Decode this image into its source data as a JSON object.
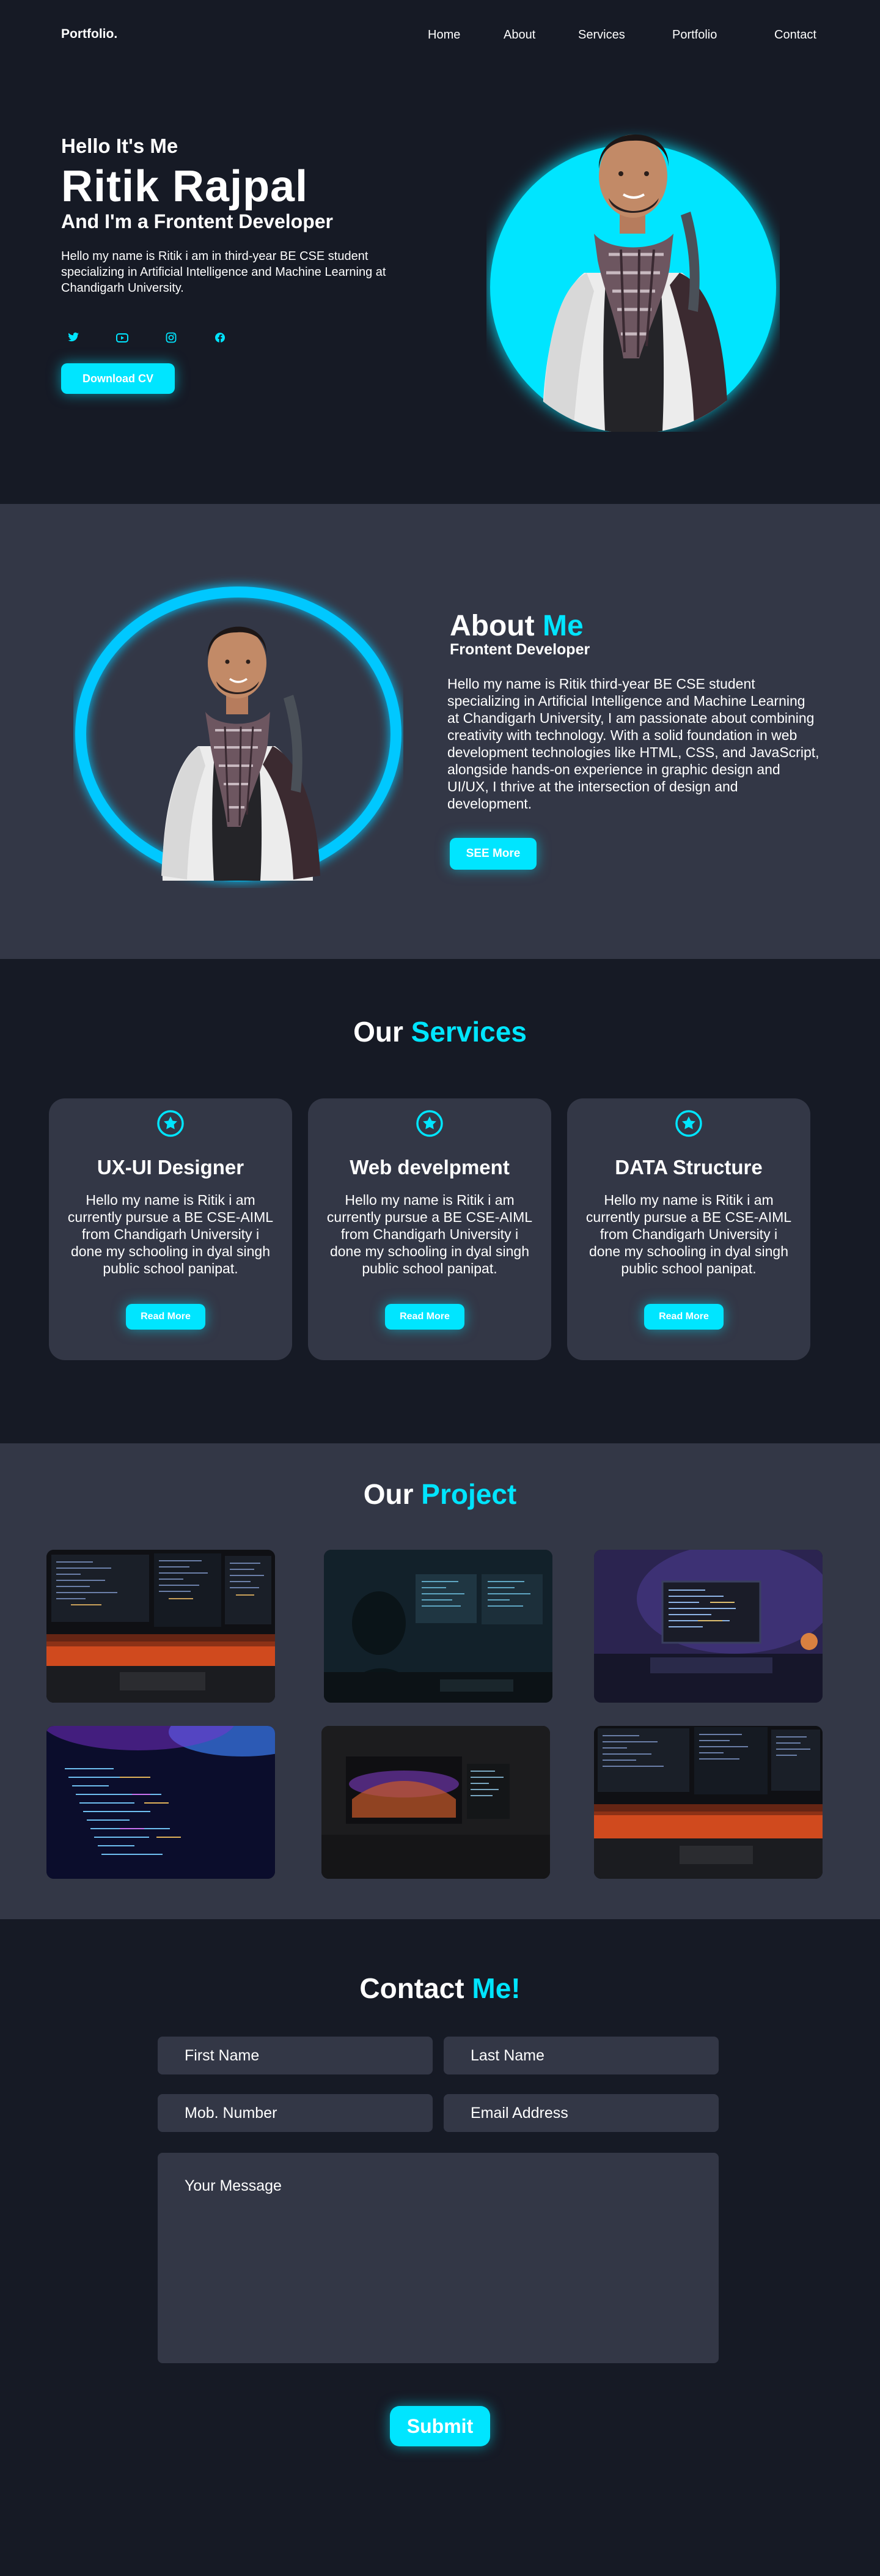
{
  "nav": {
    "logo": "Portfolio.",
    "links": [
      "Home",
      "About",
      "Services",
      "Portfolio",
      "Contact"
    ]
  },
  "hero": {
    "greeting": "Hello It's Me",
    "name": "Ritik Rajpal",
    "role": "And I'm a Frontent Developer",
    "description": "Hello my name is Ritik i am in third-year BE CSE student specializing in Artificial Intelligence and Machine Learning at Chandigarh University.",
    "socials": [
      "twitter-icon",
      "youtube-icon",
      "instagram-icon",
      "facebook-icon"
    ],
    "button": "Download CV"
  },
  "about": {
    "title_main": "About",
    "title_accent": "Me",
    "subtitle": "Frontent Developer",
    "description": "Hello my name is Ritik third-year BE CSE student specializing in Artificial Intelligence and Machine Learning at Chandigarh University, I am passionate about combining creativity with technology. With a solid foundation in web development technologies like HTML, CSS, and JavaScript, alongside hands-on experience in graphic design and UI/UX, I thrive at the intersection of design and development.",
    "button": "SEE More"
  },
  "services": {
    "title_main": "Our",
    "title_accent": "Services",
    "cards": [
      {
        "icon": "star-icon",
        "title": "UX-UI Designer",
        "description": "Hello my name is Ritik i am currently pursue a BE CSE-AIML from Chandigarh University i done my schooling in dyal singh public school panipat.",
        "button": "Read More"
      },
      {
        "icon": "star-icon",
        "title": "Web develpment",
        "description": "Hello my name is Ritik i am currently pursue a BE CSE-AIML from Chandigarh University i done my schooling in dyal singh public school panipat.",
        "button": "Read More"
      },
      {
        "icon": "star-icon",
        "title": "DATA Structure",
        "description": "Hello my name is Ritik i am currently pursue a BE CSE-AIML from Chandigarh University i done my schooling in dyal singh public school panipat.",
        "button": "Read More"
      }
    ]
  },
  "projects": {
    "title_main": "Our",
    "title_accent": "Project"
  },
  "contact": {
    "title_main": "Contact",
    "title_accent": "Me!",
    "first_name_placeholder": "First Name",
    "last_name_placeholder": "Last Name",
    "mobile_placeholder": "Mob. Number",
    "email_placeholder": "Email Address",
    "message_placeholder": "Your Message",
    "submit": "Submit"
  },
  "colors": {
    "accent": "#00e5ff",
    "background_dark": "#161a25",
    "background_light": "#333746"
  }
}
